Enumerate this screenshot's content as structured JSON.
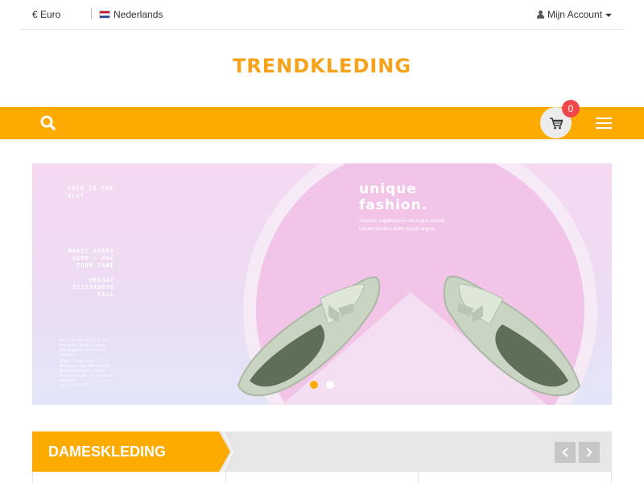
{
  "topbar": {
    "currency": "€ Euro",
    "language": "Nederlands",
    "account": "Mijn Account"
  },
  "logo": {
    "text": "TRENDKLEDING"
  },
  "nav": {
    "cart_count": "0",
    "search_icon": "search-icon",
    "cart_icon": "cart-icon",
    "menu_icon": "hamburger-menu-icon"
  },
  "banner": {
    "left_lines_1": [
      "THIS IS THE",
      "ALoT"
    ],
    "left_lines_2": [
      "MAGIC FORMA",
      "USHG - MAC",
      "FORM ZANE"
    ],
    "left_lines_3": [
      "WECHAT",
      "2327340030",
      "CALL"
    ],
    "left_lines_4": [
      "Wall for the world' a tool",
      "Wholesale fashion, Dubai",
      "and Uniquely accessible",
      "fashion."
    ],
    "left_lines_5": [
      "Ahmet's shop trade",
      "Wholesale Cost Methodology",
      "Delivered Online Forever.",
      "Accessible the two Fashionen",
      "Bestfoot",
      "prts h Bestfoot."
    ],
    "title_line1": "unique",
    "title_line2": "fashion.",
    "subtitle": "Vivamus sagittis lacus vel augue laoreet rutrum faucibus dolor auctor augue.",
    "slides": 2,
    "active_slide": 1
  },
  "section": {
    "title": "DAMESKLEDING"
  },
  "colors": {
    "accent": "#fdab00",
    "logo": "#f7a21b",
    "badge": "#f0484a",
    "banner_pink": "#f1c4e8"
  }
}
